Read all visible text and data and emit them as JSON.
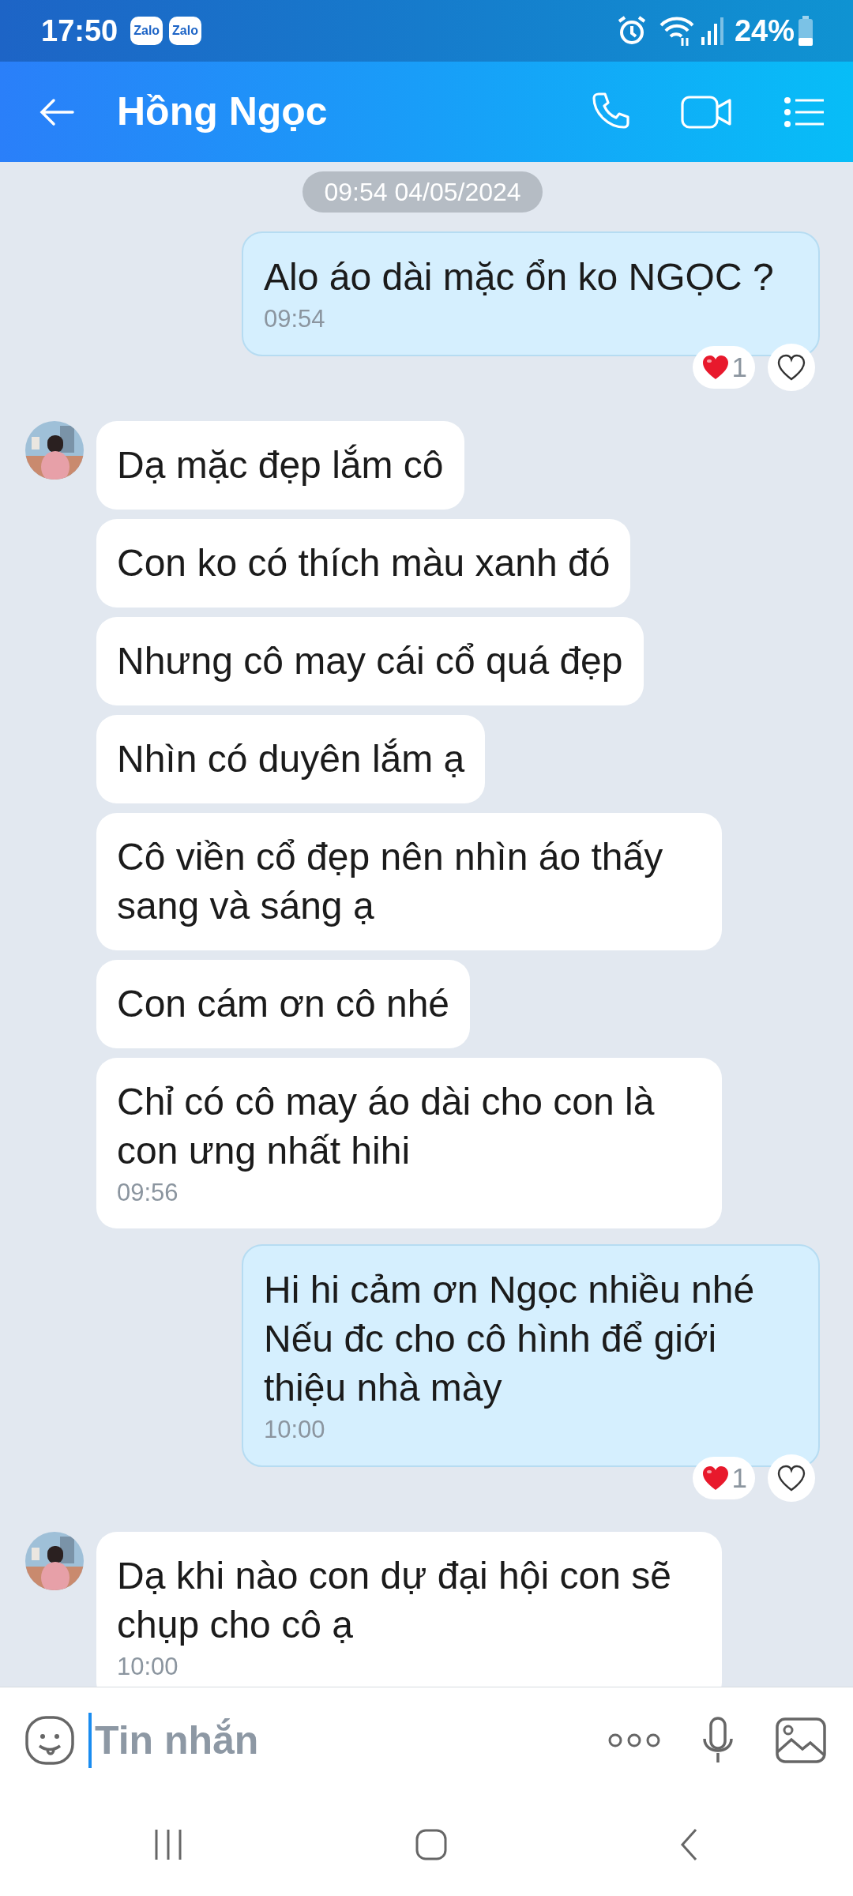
{
  "status_bar": {
    "time": "17:50",
    "notifications": [
      {
        "label": "Zalo"
      },
      {
        "label": "Zalo"
      }
    ],
    "battery": "24%"
  },
  "header": {
    "title": "Hồng Ngọc"
  },
  "messages": [
    {
      "kind": "date",
      "text": "09:54 04/05/2024"
    },
    {
      "kind": "out",
      "text": "Alo áo dài mặc ổn ko NGỌC ?",
      "time": "09:54",
      "reaction_count": "1"
    },
    {
      "kind": "in",
      "avatar": true,
      "text": "Dạ mặc đẹp lắm cô"
    },
    {
      "kind": "in",
      "avatar": false,
      "text": "Con ko có thích màu xanh đó"
    },
    {
      "kind": "in",
      "avatar": false,
      "text": "Nhưng cô may cái cổ quá đẹp"
    },
    {
      "kind": "in",
      "avatar": false,
      "text": "Nhìn có duyên lắm ạ"
    },
    {
      "kind": "in",
      "avatar": false,
      "text": "Cô viền cổ đẹp nên nhìn áo thấy sang và sáng ạ"
    },
    {
      "kind": "in",
      "avatar": false,
      "text": "Con cám ơn cô nhé"
    },
    {
      "kind": "in",
      "avatar": false,
      "text": "Chỉ có cô may áo dài cho con là con ưng nhất hihi",
      "time": "09:56"
    },
    {
      "kind": "out",
      "text": "Hi hi cảm ơn Ngọc nhiều nhé\nNếu đc cho cô hình để giới thiệu nhà mày",
      "time": "10:00",
      "reaction_count": "1"
    },
    {
      "kind": "in",
      "avatar": true,
      "text": "Dạ khi nào con dự đại hội con sẽ chụp cho cô ạ",
      "time": "10:00"
    }
  ],
  "composer": {
    "placeholder": "Tin nhắn"
  }
}
